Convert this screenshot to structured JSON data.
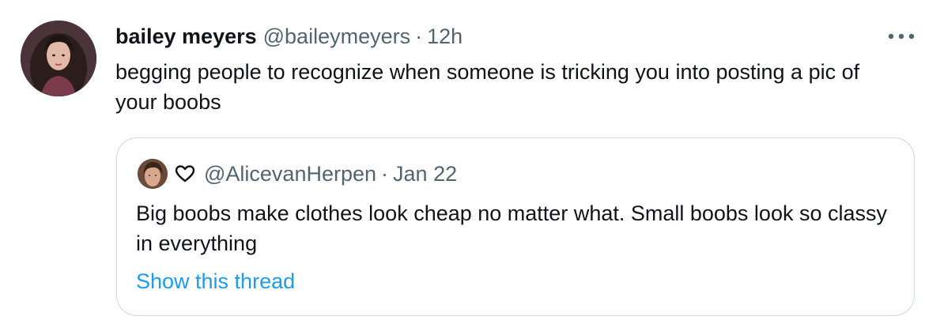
{
  "tweet": {
    "author_name": "bailey meyers",
    "author_handle": "@baileymeyers",
    "separator": "·",
    "time": "12h",
    "text": "begging people to recognize when someone is tricking you into posting a pic of your boobs",
    "avatar_icon": "user-avatar-photo",
    "more_icon": "more-options-icon"
  },
  "quoted_tweet": {
    "author_handle": "@AlicevanHerpen",
    "separator": "·",
    "date": "Jan 22",
    "text": "Big boobs make clothes look cheap no matter what. Small boobs look so classy in everything",
    "show_thread_label": "Show this thread",
    "avatar_icon": "user-avatar-photo",
    "badge_icon": "heart-outline-icon"
  },
  "colors": {
    "primary_text": "#0f1419",
    "secondary_text": "#536471",
    "link": "#1d9bf0",
    "border": "#cfd9de",
    "background": "#ffffff"
  }
}
